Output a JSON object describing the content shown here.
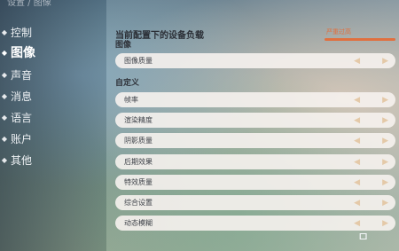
{
  "breadcrumb": "设置 / 图像",
  "sidebar": {
    "items": [
      {
        "label": "控制"
      },
      {
        "label": "图像"
      },
      {
        "label": "声音"
      },
      {
        "label": "消息"
      },
      {
        "label": "语言"
      },
      {
        "label": "账户"
      },
      {
        "label": "其他"
      }
    ],
    "active_index": 1
  },
  "load": {
    "title": "当前配置下的设备负载",
    "status": "严重过高",
    "color": "#e0703f"
  },
  "sections": {
    "image_title": "图像",
    "custom_title": "自定义"
  },
  "rows": [
    {
      "label": "图像质量"
    },
    {
      "label": "帧率"
    },
    {
      "label": "渲染精度"
    },
    {
      "label": "阴影质量"
    },
    {
      "label": "后期效果"
    },
    {
      "label": "特效质量"
    },
    {
      "label": "综合设置"
    },
    {
      "label": "动态模糊"
    }
  ],
  "helper_glyph": "ㅁ"
}
